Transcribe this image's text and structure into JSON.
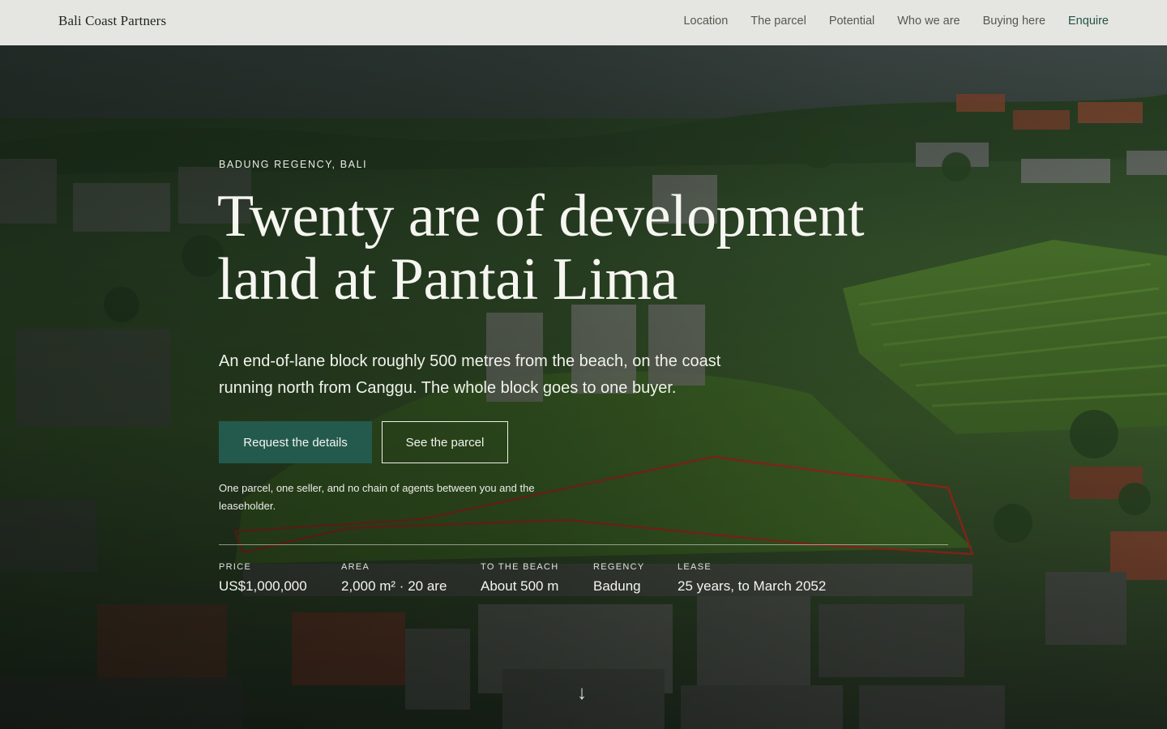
{
  "nav": {
    "brand": "Bali Coast Partners",
    "links": [
      "Location",
      "The parcel",
      "Potential",
      "Who we are",
      "Buying here",
      "Enquire"
    ]
  },
  "hero": {
    "eyebrow": "BADUNG REGENCY, BALI",
    "headline_line1": "Twenty are of development",
    "headline_line2": "land at Pantai Lima",
    "lede": "An end-of-lane block roughly 500 metres from the beach, on the coast running north from Canggu. The whole block goes to one buyer.",
    "primary_cta": "Request the details",
    "secondary_cta": "See the parcel",
    "note": "One parcel, one seller, and no chain of agents between you and the leaseholder.",
    "scroll_glyph": "↓"
  },
  "facts": [
    {
      "label": "PRICE",
      "value": "US$1,000,000"
    },
    {
      "label": "AREA",
      "value": "2,000 m² · 20 are"
    },
    {
      "label": "TO THE BEACH",
      "value": "About 500 m"
    },
    {
      "label": "REGENCY",
      "value": "Badung"
    },
    {
      "label": "LEASE",
      "value": "25 years, to March 2052"
    }
  ],
  "colors": {
    "accent": "#245a4e",
    "nav_bg": "#e5e6e1",
    "parcel_outline": "#c0271f"
  },
  "icons": {
    "scroll": "arrow-down-icon"
  }
}
